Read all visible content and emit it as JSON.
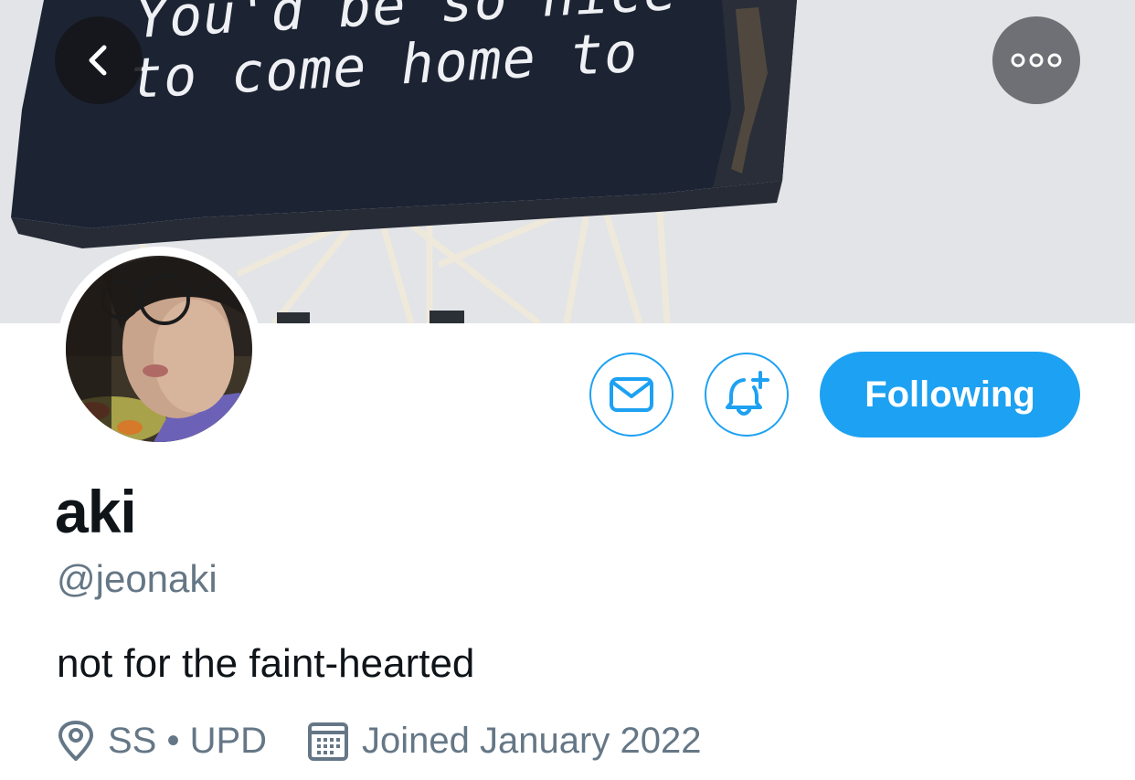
{
  "banner": {
    "billboard_line_1": "You'd be so nice",
    "billboard_line_2": "to come home to"
  },
  "nav": {
    "back_icon": "chevron-left-icon",
    "more_icon": "more-horizontal-icon"
  },
  "actions": {
    "message_icon": "envelope-icon",
    "notifications_icon": "bell-plus-icon",
    "follow_label": "Following"
  },
  "profile": {
    "display_name": "aki",
    "handle": "@jeonaki",
    "bio": "not for the faint-hearted",
    "location": "SS • UPD",
    "joined": "Joined January 2022"
  },
  "colors": {
    "accent": "#1da1f2",
    "secondary_text": "#657786",
    "primary_text": "#0f1419"
  }
}
